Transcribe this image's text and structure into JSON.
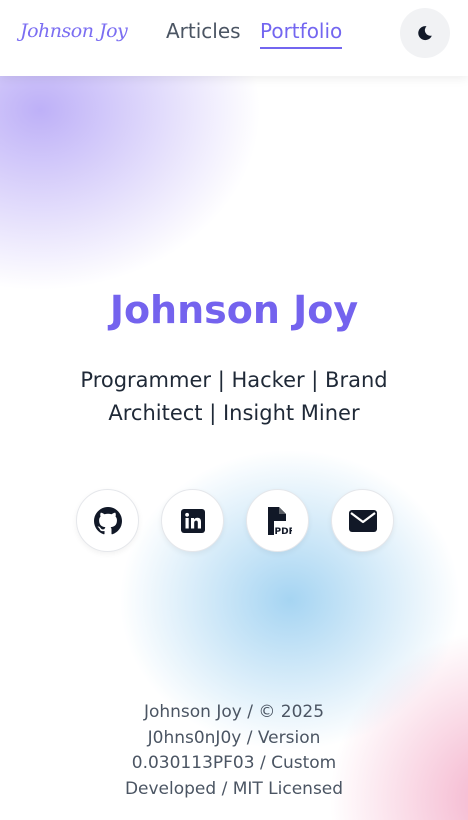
{
  "header": {
    "logo": "Johnson Joy",
    "nav": [
      {
        "label": "Articles",
        "active": false
      },
      {
        "label": "Portfolio",
        "active": true
      }
    ],
    "theme_toggle_icon": "moon-icon"
  },
  "hero": {
    "name": "Johnson Joy",
    "tagline": "Programmer | Hacker | Brand Architect | Insight Miner"
  },
  "social_links": [
    {
      "icon": "github-icon"
    },
    {
      "icon": "linkedin-icon"
    },
    {
      "icon": "file-pdf-icon",
      "text": "PDF"
    },
    {
      "icon": "envelope-icon"
    }
  ],
  "footer": {
    "text": "Johnson Joy / © 2025 J0hns0nJ0y / Version 0.030113PF03 / Custom Developed / MIT Licensed"
  },
  "colors": {
    "accent": "#7463ee",
    "text_dark": "#1f2937",
    "text_muted": "#4b5563"
  }
}
